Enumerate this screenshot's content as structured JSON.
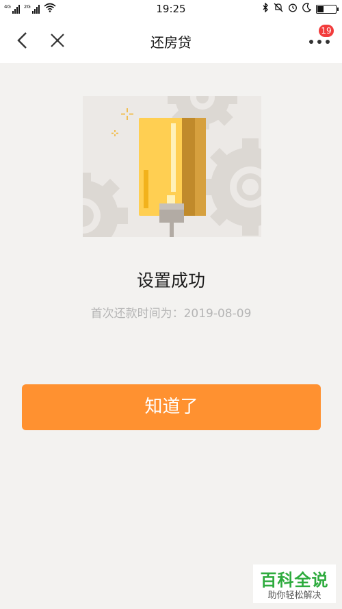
{
  "status_bar": {
    "sim1_label": "4G",
    "sim2_label": "2G",
    "time": "19:25",
    "icons": [
      "signal-icon",
      "wifi-icon",
      "bluetooth-icon",
      "mute-bell-icon",
      "alarm-icon",
      "moon-icon",
      "battery-icon"
    ]
  },
  "nav": {
    "title": "还房贷",
    "badge_count": "19"
  },
  "main": {
    "title": "设置成功",
    "subtitle": "首次还款时间为：2019-08-09",
    "button_label": "知道了"
  },
  "watermark": {
    "title": "百科全说",
    "subtitle": "助你轻松解决"
  },
  "colors": {
    "accent": "#ff9130",
    "background": "#f3f2f0",
    "badge": "#f23c3c",
    "card": "#ffcf52",
    "watermark": "#2eab3e"
  }
}
